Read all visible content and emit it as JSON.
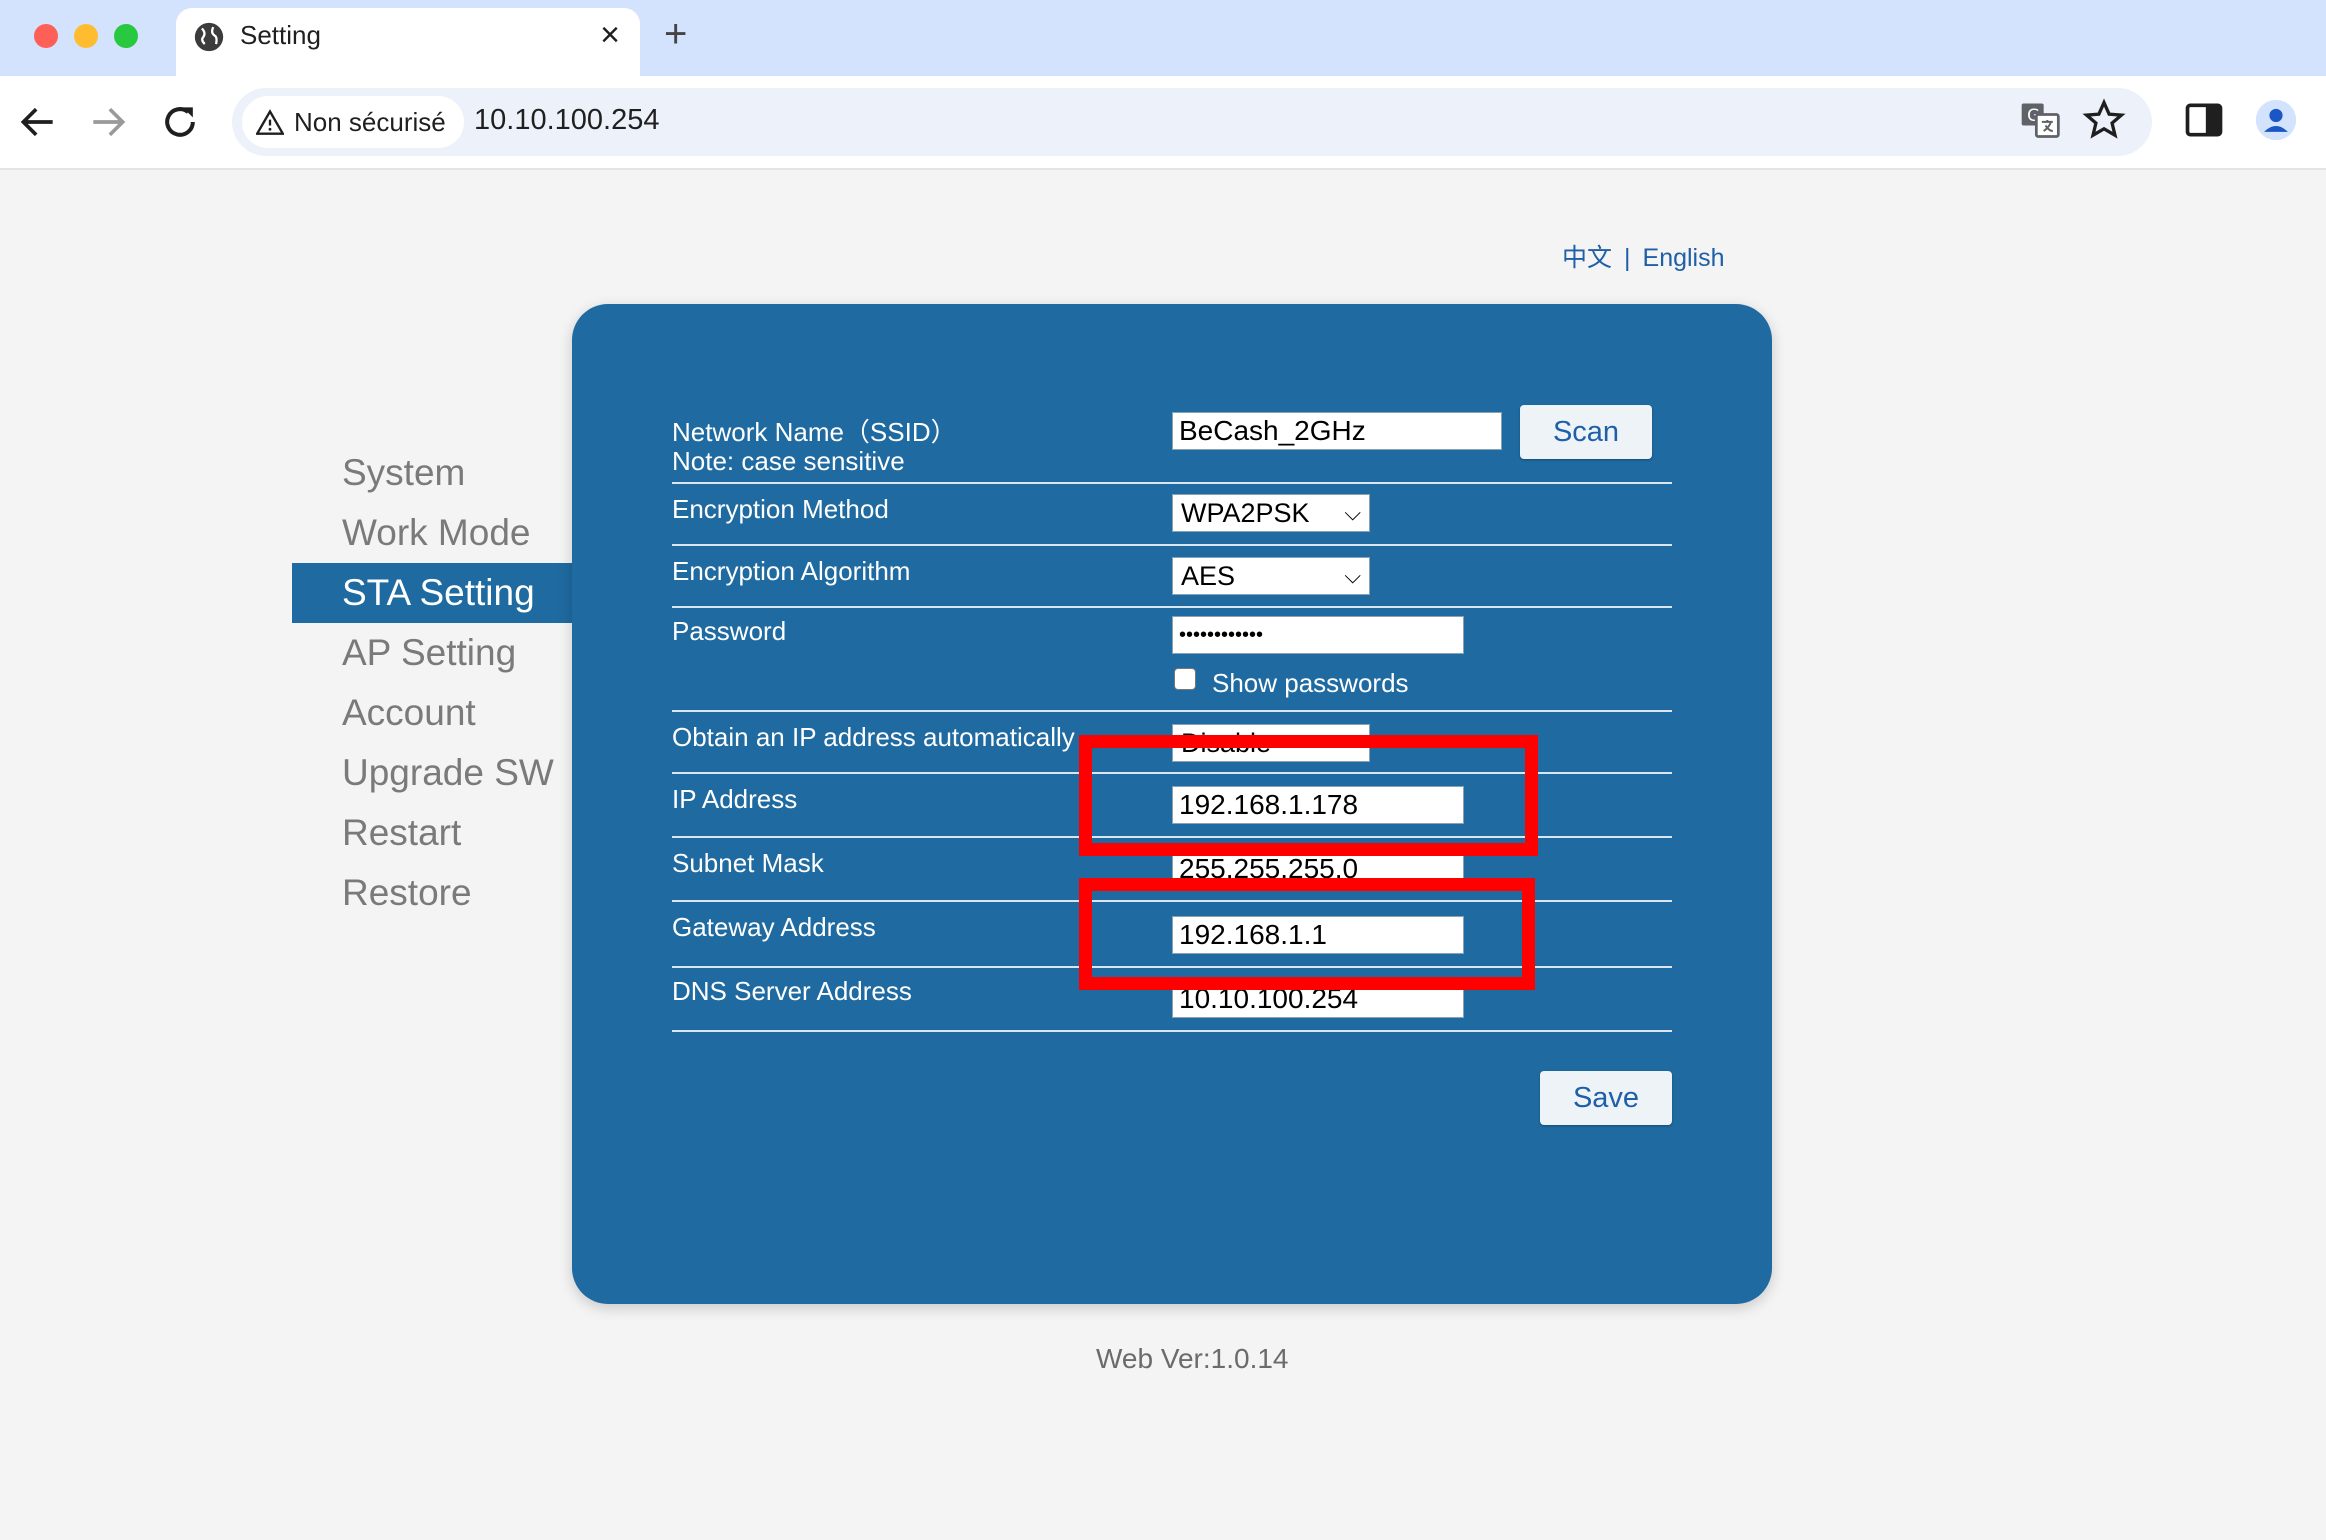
{
  "browser": {
    "tab_title": "Setting",
    "tab_close": "×",
    "new_tab": "+",
    "security_label": "Non sécurisé",
    "url": "10.10.100.254"
  },
  "lang": {
    "zh": "中文",
    "sep": "|",
    "en": "English"
  },
  "sidebar": {
    "items": [
      {
        "label": "System"
      },
      {
        "label": "Work Mode"
      },
      {
        "label": "STA Setting"
      },
      {
        "label": "AP Setting"
      },
      {
        "label": "Account"
      },
      {
        "label": "Upgrade SW"
      },
      {
        "label": "Restart"
      },
      {
        "label": "Restore"
      }
    ],
    "active": "STA Setting"
  },
  "form": {
    "ssid_label": "Network Name（SSID）",
    "ssid_note": "Note: case sensitive",
    "ssid_value": "BeCash_2GHz",
    "scan_label": "Scan",
    "enc_method_label": "Encryption Method",
    "enc_method_value": "WPA2PSK",
    "enc_algo_label": "Encryption Algorithm",
    "enc_algo_value": "AES",
    "password_label": "Password",
    "password_value": "••••••••••••",
    "show_pw_label": "Show passwords",
    "dhcp_label": "Obtain an IP address automatically",
    "dhcp_value": "Disable",
    "ip_label": "IP Address",
    "ip_value": "192.168.1.178",
    "mask_label": "Subnet Mask",
    "mask_value": "255.255.255.0",
    "gw_label": "Gateway Address",
    "gw_value": "192.168.1.1",
    "dns_label": "DNS Server Address",
    "dns_value": "10.10.100.254",
    "save_label": "Save"
  },
  "footer": {
    "version": "Web Ver:1.0.14"
  },
  "colors": {
    "panel": "#1f6aa0",
    "highlight": "#ff0000",
    "link": "#1e5fa8"
  }
}
